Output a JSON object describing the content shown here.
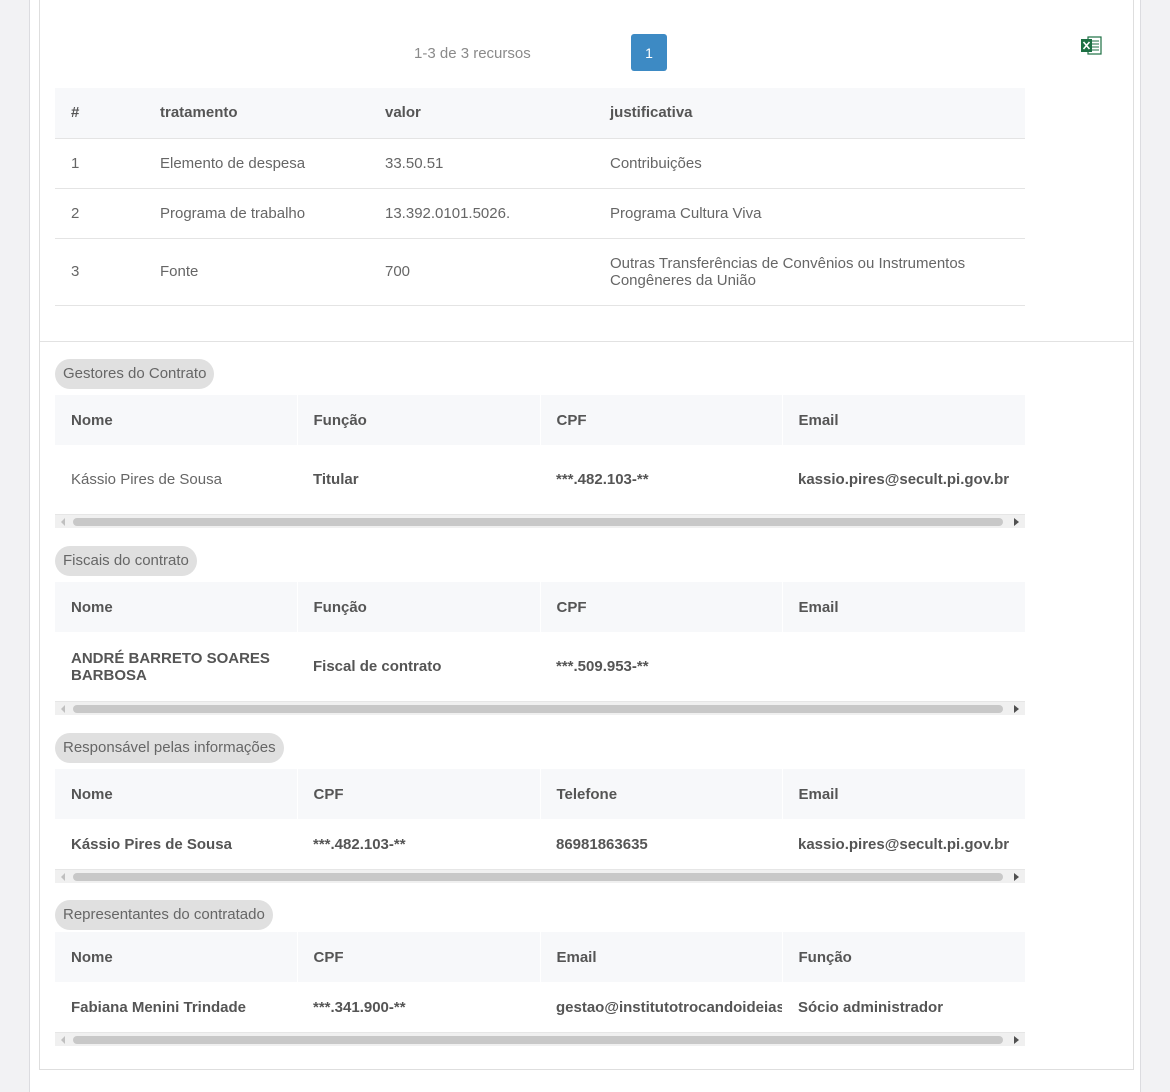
{
  "pagination": {
    "info": "1-3 de 3 recursos",
    "current_page": "1"
  },
  "icons": {
    "export": "excel-icon"
  },
  "colors": {
    "accent": "#3d8ac4",
    "excel": "#1d7044"
  },
  "recursos": {
    "headers": [
      "#",
      "tratamento",
      "valor",
      "justificativa"
    ],
    "rows": [
      [
        "1",
        "Elemento de despesa",
        "33.50.51",
        "Contribuições"
      ],
      [
        "2",
        "Programa de trabalho",
        "13.392.0101.5026.",
        "Programa Cultura Viva"
      ],
      [
        "3",
        "Fonte",
        "700",
        "Outras Transferências de Convênios ou Instrumentos Congêneres da União"
      ]
    ]
  },
  "gestores": {
    "title": "Gestores do Contrato",
    "headers": [
      "Nome",
      "Função",
      "CPF",
      "Email"
    ],
    "rows": [
      [
        "Kássio Pires de Sousa",
        "Titular",
        "***.482.103-**",
        "kassio.pires@secult.pi.gov.br"
      ]
    ]
  },
  "fiscais": {
    "title": "Fiscais do contrato",
    "headers": [
      "Nome",
      "Função",
      "CPF",
      "Email"
    ],
    "rows": [
      [
        "ANDRÉ BARRETO SOARES BARBOSA",
        "Fiscal de contrato",
        "***.509.953-**",
        ""
      ]
    ]
  },
  "responsavel": {
    "title": "Responsável pelas informações",
    "headers": [
      "Nome",
      "CPF",
      "Telefone",
      "Email"
    ],
    "rows": [
      [
        "Kássio Pires de Sousa",
        "***.482.103-**",
        "86981863635",
        "kassio.pires@secult.pi.gov.br"
      ]
    ]
  },
  "representantes": {
    "title": "Representantes do contratado",
    "headers": [
      "Nome",
      "CPF",
      "Email",
      "Função"
    ],
    "rows": [
      [
        "Fabiana Menini Trindade",
        "***.341.900-**",
        "gestao@institutotrocandoideias",
        "Sócio administrador"
      ]
    ]
  }
}
